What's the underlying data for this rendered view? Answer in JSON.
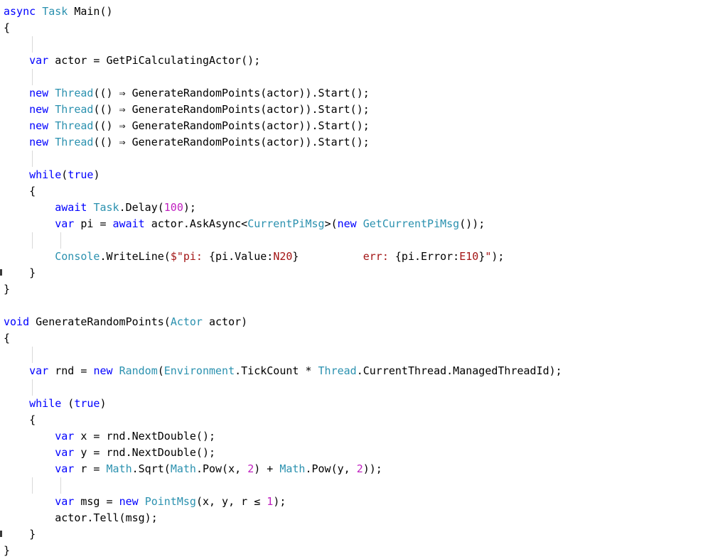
{
  "editor": {
    "language": "csharp",
    "background": "#ffffff",
    "font_size_px": 15,
    "line_height_px": 23,
    "colors": {
      "keyword": "#0000FF",
      "type": "#2B91AF",
      "number": "#C020C0",
      "string": "#A31515",
      "plain": "#000000",
      "indent_guide": "#D8D8D8",
      "background": "#FFFFFF"
    },
    "ligatures": {
      "fat_arrow": "⇒",
      "less_or_equal": "≤"
    }
  },
  "code": {
    "lines": [
      {
        "indent": 0,
        "guides": [],
        "tokens": [
          {
            "c": "kw",
            "t": "async"
          },
          {
            "c": "pln",
            "t": " "
          },
          {
            "c": "typ",
            "t": "Task"
          },
          {
            "c": "pln",
            "t": " Main()"
          }
        ]
      },
      {
        "indent": 0,
        "guides": [],
        "tokens": [
          {
            "c": "pln",
            "t": "{"
          }
        ]
      },
      {
        "indent": 0,
        "guides": [
          "g1"
        ],
        "tokens": []
      },
      {
        "indent": 0,
        "guides": [],
        "tokens": [
          {
            "c": "pln",
            "t": "    "
          },
          {
            "c": "kw",
            "t": "var"
          },
          {
            "c": "pln",
            "t": " actor = GetPiCalculatingActor();"
          }
        ]
      },
      {
        "indent": 0,
        "guides": [
          "g1"
        ],
        "tokens": []
      },
      {
        "indent": 0,
        "guides": [],
        "tokens": [
          {
            "c": "pln",
            "t": "    "
          },
          {
            "c": "kw",
            "t": "new"
          },
          {
            "c": "pln",
            "t": " "
          },
          {
            "c": "typ",
            "t": "Thread"
          },
          {
            "c": "pln",
            "t": "(() ⇒ GenerateRandomPoints(actor)).Start();"
          }
        ]
      },
      {
        "indent": 0,
        "guides": [],
        "tokens": [
          {
            "c": "pln",
            "t": "    "
          },
          {
            "c": "kw",
            "t": "new"
          },
          {
            "c": "pln",
            "t": " "
          },
          {
            "c": "typ",
            "t": "Thread"
          },
          {
            "c": "pln",
            "t": "(() ⇒ GenerateRandomPoints(actor)).Start();"
          }
        ]
      },
      {
        "indent": 0,
        "guides": [],
        "tokens": [
          {
            "c": "pln",
            "t": "    "
          },
          {
            "c": "kw",
            "t": "new"
          },
          {
            "c": "pln",
            "t": " "
          },
          {
            "c": "typ",
            "t": "Thread"
          },
          {
            "c": "pln",
            "t": "(() ⇒ GenerateRandomPoints(actor)).Start();"
          }
        ]
      },
      {
        "indent": 0,
        "guides": [],
        "tokens": [
          {
            "c": "pln",
            "t": "    "
          },
          {
            "c": "kw",
            "t": "new"
          },
          {
            "c": "pln",
            "t": " "
          },
          {
            "c": "typ",
            "t": "Thread"
          },
          {
            "c": "pln",
            "t": "(() ⇒ GenerateRandomPoints(actor)).Start();"
          }
        ]
      },
      {
        "indent": 0,
        "guides": [
          "g1"
        ],
        "tokens": []
      },
      {
        "indent": 0,
        "guides": [],
        "tokens": [
          {
            "c": "pln",
            "t": "    "
          },
          {
            "c": "kw",
            "t": "while"
          },
          {
            "c": "pln",
            "t": "("
          },
          {
            "c": "kw",
            "t": "true"
          },
          {
            "c": "pln",
            "t": ")"
          }
        ]
      },
      {
        "indent": 0,
        "guides": [],
        "tokens": [
          {
            "c": "pln",
            "t": "    {"
          }
        ]
      },
      {
        "indent": 0,
        "guides": [],
        "tokens": [
          {
            "c": "pln",
            "t": "        "
          },
          {
            "c": "kw",
            "t": "await"
          },
          {
            "c": "pln",
            "t": " "
          },
          {
            "c": "typ",
            "t": "Task"
          },
          {
            "c": "pln",
            "t": ".Delay("
          },
          {
            "c": "num",
            "t": "100"
          },
          {
            "c": "pln",
            "t": ");"
          }
        ]
      },
      {
        "indent": 0,
        "guides": [],
        "tokens": [
          {
            "c": "pln",
            "t": "        "
          },
          {
            "c": "kw",
            "t": "var"
          },
          {
            "c": "pln",
            "t": " pi = "
          },
          {
            "c": "kw",
            "t": "await"
          },
          {
            "c": "pln",
            "t": " actor.AskAsync<"
          },
          {
            "c": "typ",
            "t": "CurrentPiMsg"
          },
          {
            "c": "pln",
            "t": ">("
          },
          {
            "c": "kw",
            "t": "new"
          },
          {
            "c": "pln",
            "t": " "
          },
          {
            "c": "typ",
            "t": "GetCurrentPiMsg"
          },
          {
            "c": "pln",
            "t": "());"
          }
        ]
      },
      {
        "indent": 0,
        "guides": [
          "g1",
          "g2"
        ],
        "tokens": []
      },
      {
        "indent": 0,
        "guides": [],
        "tokens": [
          {
            "c": "pln",
            "t": "        "
          },
          {
            "c": "typ",
            "t": "Console"
          },
          {
            "c": "pln",
            "t": ".WriteLine("
          },
          {
            "c": "str",
            "t": "$\"pi: "
          },
          {
            "c": "pln",
            "t": "{pi.Value:"
          },
          {
            "c": "str",
            "t": "N20"
          },
          {
            "c": "pln",
            "t": "}"
          },
          {
            "c": "str",
            "t": "          err: "
          },
          {
            "c": "pln",
            "t": "{pi.Error:"
          },
          {
            "c": "str",
            "t": "E10"
          },
          {
            "c": "pln",
            "t": "}"
          },
          {
            "c": "str",
            "t": "\""
          },
          {
            "c": "pln",
            "t": ");"
          }
        ]
      },
      {
        "indent": 0,
        "guides": [],
        "tokens": [
          {
            "c": "pln",
            "t": "    }"
          }
        ],
        "edge_mark": true
      },
      {
        "indent": 0,
        "guides": [],
        "tokens": [
          {
            "c": "pln",
            "t": "}"
          }
        ]
      },
      {
        "indent": 0,
        "guides": [],
        "tokens": []
      },
      {
        "indent": 0,
        "guides": [],
        "tokens": [
          {
            "c": "kw",
            "t": "void"
          },
          {
            "c": "pln",
            "t": " GenerateRandomPoints("
          },
          {
            "c": "typ",
            "t": "Actor"
          },
          {
            "c": "pln",
            "t": " actor)"
          }
        ]
      },
      {
        "indent": 0,
        "guides": [],
        "tokens": [
          {
            "c": "pln",
            "t": "{"
          }
        ]
      },
      {
        "indent": 0,
        "guides": [
          "g1"
        ],
        "tokens": []
      },
      {
        "indent": 0,
        "guides": [],
        "tokens": [
          {
            "c": "pln",
            "t": "    "
          },
          {
            "c": "kw",
            "t": "var"
          },
          {
            "c": "pln",
            "t": " rnd = "
          },
          {
            "c": "kw",
            "t": "new"
          },
          {
            "c": "pln",
            "t": " "
          },
          {
            "c": "typ",
            "t": "Random"
          },
          {
            "c": "pln",
            "t": "("
          },
          {
            "c": "typ",
            "t": "Environment"
          },
          {
            "c": "pln",
            "t": ".TickCount * "
          },
          {
            "c": "typ",
            "t": "Thread"
          },
          {
            "c": "pln",
            "t": ".CurrentThread.ManagedThreadId);"
          }
        ]
      },
      {
        "indent": 0,
        "guides": [
          "g1"
        ],
        "tokens": []
      },
      {
        "indent": 0,
        "guides": [],
        "tokens": [
          {
            "c": "pln",
            "t": "    "
          },
          {
            "c": "kw",
            "t": "while"
          },
          {
            "c": "pln",
            "t": " ("
          },
          {
            "c": "kw",
            "t": "true"
          },
          {
            "c": "pln",
            "t": ")"
          }
        ]
      },
      {
        "indent": 0,
        "guides": [],
        "tokens": [
          {
            "c": "pln",
            "t": "    {"
          }
        ]
      },
      {
        "indent": 0,
        "guides": [],
        "tokens": [
          {
            "c": "pln",
            "t": "        "
          },
          {
            "c": "kw",
            "t": "var"
          },
          {
            "c": "pln",
            "t": " x = rnd.NextDouble();"
          }
        ]
      },
      {
        "indent": 0,
        "guides": [],
        "tokens": [
          {
            "c": "pln",
            "t": "        "
          },
          {
            "c": "kw",
            "t": "var"
          },
          {
            "c": "pln",
            "t": " y = rnd.NextDouble();"
          }
        ]
      },
      {
        "indent": 0,
        "guides": [],
        "tokens": [
          {
            "c": "pln",
            "t": "        "
          },
          {
            "c": "kw",
            "t": "var"
          },
          {
            "c": "pln",
            "t": " r = "
          },
          {
            "c": "typ",
            "t": "Math"
          },
          {
            "c": "pln",
            "t": ".Sqrt("
          },
          {
            "c": "typ",
            "t": "Math"
          },
          {
            "c": "pln",
            "t": ".Pow(x, "
          },
          {
            "c": "num",
            "t": "2"
          },
          {
            "c": "pln",
            "t": ") + "
          },
          {
            "c": "typ",
            "t": "Math"
          },
          {
            "c": "pln",
            "t": ".Pow(y, "
          },
          {
            "c": "num",
            "t": "2"
          },
          {
            "c": "pln",
            "t": "));"
          }
        ]
      },
      {
        "indent": 0,
        "guides": [
          "g1",
          "g2"
        ],
        "tokens": []
      },
      {
        "indent": 0,
        "guides": [],
        "tokens": [
          {
            "c": "pln",
            "t": "        "
          },
          {
            "c": "kw",
            "t": "var"
          },
          {
            "c": "pln",
            "t": " msg = "
          },
          {
            "c": "kw",
            "t": "new"
          },
          {
            "c": "pln",
            "t": " "
          },
          {
            "c": "typ",
            "t": "PointMsg"
          },
          {
            "c": "pln",
            "t": "(x, y, r ≤ "
          },
          {
            "c": "num",
            "t": "1"
          },
          {
            "c": "pln",
            "t": ");"
          }
        ]
      },
      {
        "indent": 0,
        "guides": [],
        "tokens": [
          {
            "c": "pln",
            "t": "        actor.Tell(msg);"
          }
        ]
      },
      {
        "indent": 0,
        "guides": [],
        "tokens": [
          {
            "c": "pln",
            "t": "    }"
          }
        ],
        "edge_mark": true
      },
      {
        "indent": 0,
        "guides": [],
        "tokens": [
          {
            "c": "pln",
            "t": "}"
          }
        ]
      }
    ]
  }
}
